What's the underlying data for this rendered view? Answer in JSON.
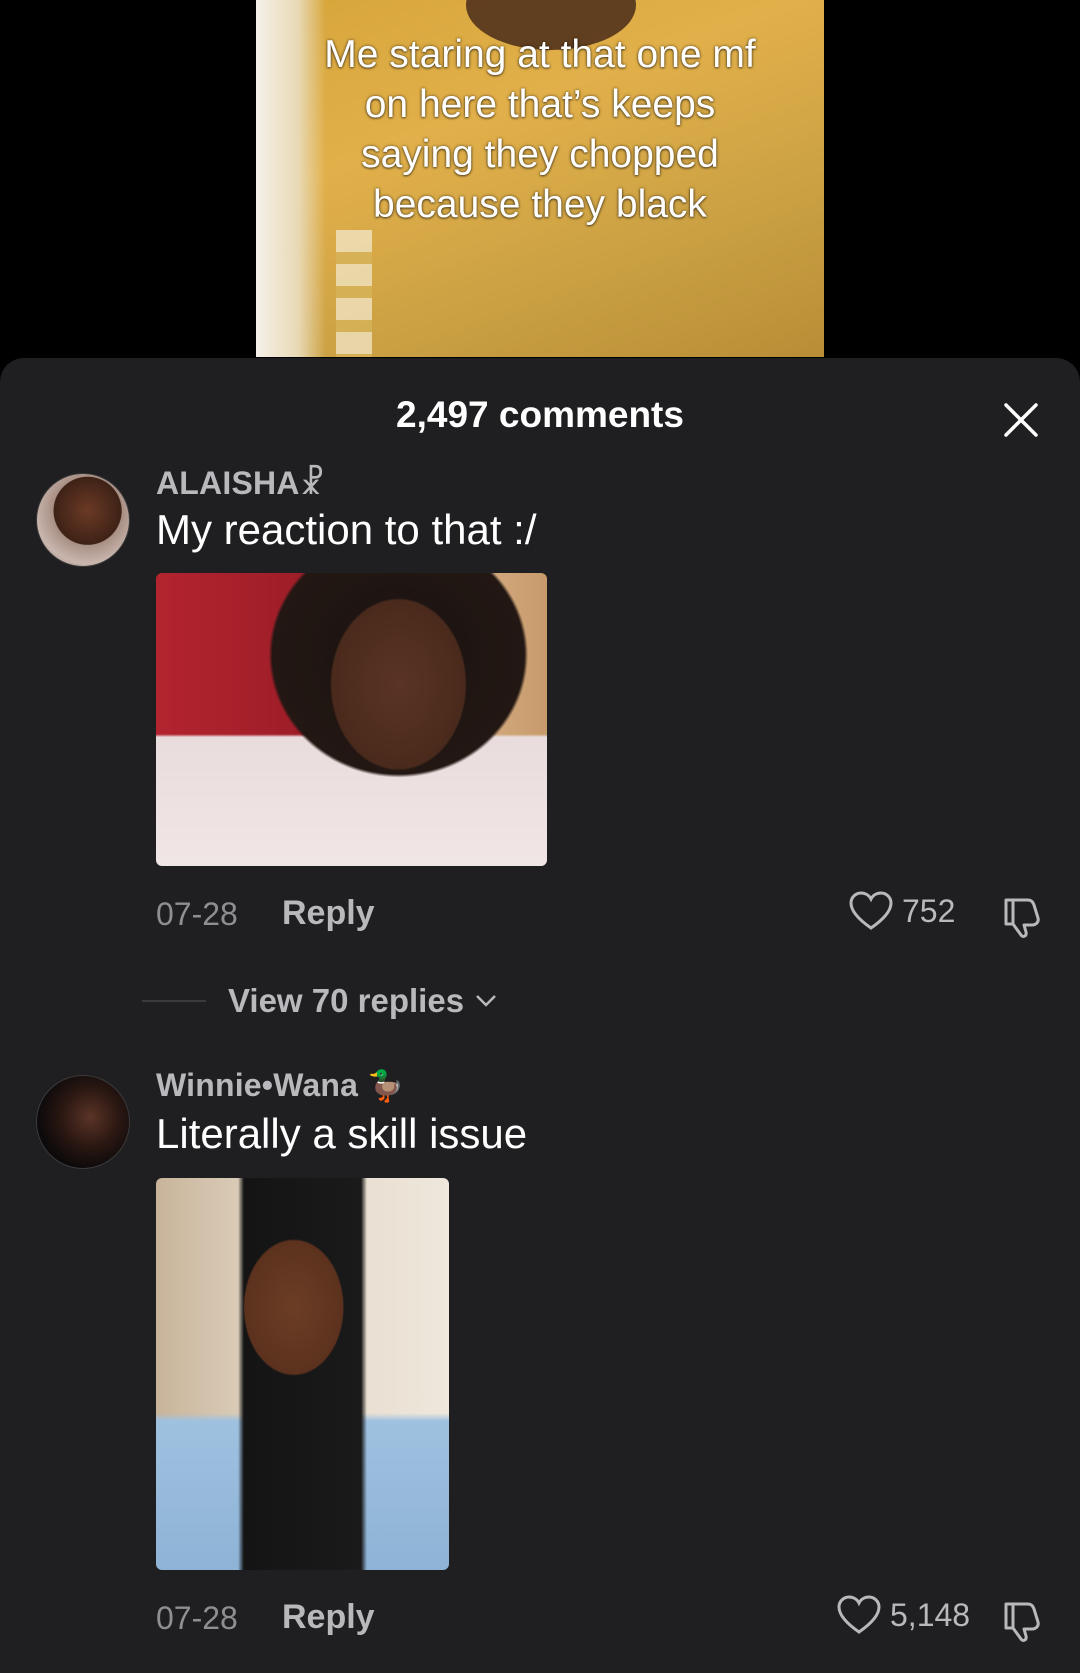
{
  "video": {
    "caption": "Me staring at that one mf\non here that’s keeps\nsaying they chopped\nbecause they black"
  },
  "sheet": {
    "title": "2,497 comments"
  },
  "comments": [
    {
      "username": "ALAISHA☧",
      "text": "My reaction to that :/",
      "date": "07-28",
      "reply_label": "Reply",
      "likes": "752"
    },
    {
      "username": "Winnie•Wana",
      "username_emoji": "🦆",
      "text": "Literally a skill issue",
      "date": "07-28",
      "reply_label": "Reply",
      "likes": "5,148"
    }
  ],
  "view_replies": {
    "label": "View 70 replies"
  },
  "colors": {
    "sheet_bg": "#1f1f21",
    "muted_text": "#8e8e93",
    "secondary_text": "#b9b9bd"
  }
}
